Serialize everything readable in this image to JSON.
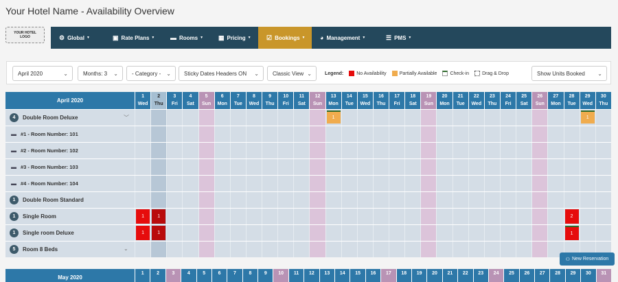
{
  "page_title": "Your Hotel Name - Availability Overview",
  "logo_text": "YOUR HOTEL LOGO",
  "nav": [
    {
      "label": "Global",
      "icon": "gear-icon",
      "glyph": "⚙"
    },
    {
      "label": "Rate Plans",
      "icon": "briefcase-icon",
      "glyph": "▣"
    },
    {
      "label": "Rooms",
      "icon": "bed-icon",
      "glyph": "▬"
    },
    {
      "label": "Pricing",
      "icon": "table-icon",
      "glyph": "▦"
    },
    {
      "label": "Bookings",
      "icon": "calendar-check-icon",
      "glyph": "☑"
    },
    {
      "label": "Management",
      "icon": "pie-chart-icon",
      "glyph": "◕"
    },
    {
      "label": "PMS",
      "icon": "list-icon",
      "glyph": "☰"
    }
  ],
  "toolbar": {
    "month": "April 2020",
    "months": "Months: 3",
    "category": "- Category -",
    "sticky": "Sticky Dates Headers ON",
    "view": "Classic View",
    "legend_label": "Legend:",
    "legend": [
      {
        "label": "No Availability",
        "color": "#e60c0c"
      },
      {
        "label": "Partially Available",
        "color": "#f0ac4e"
      },
      {
        "label": "Check-in",
        "color": "#2f6a2a"
      },
      {
        "label": "Drag & Drop",
        "color": "#333333"
      }
    ],
    "units": "Show Units Booked"
  },
  "calendar1": {
    "title": "April 2020",
    "days": [
      [
        "1",
        "Wed"
      ],
      [
        "2",
        "Thu"
      ],
      [
        "3",
        "Fri"
      ],
      [
        "4",
        "Sat"
      ],
      [
        "5",
        "Sun"
      ],
      [
        "6",
        "Mon"
      ],
      [
        "7",
        "Tue"
      ],
      [
        "8",
        "Wed"
      ],
      [
        "9",
        "Thu"
      ],
      [
        "10",
        "Fri"
      ],
      [
        "11",
        "Sat"
      ],
      [
        "12",
        "Sun"
      ],
      [
        "13",
        "Mon"
      ],
      [
        "14",
        "Tue"
      ],
      [
        "15",
        "Wed"
      ],
      [
        "16",
        "Thu"
      ],
      [
        "17",
        "Fri"
      ],
      [
        "18",
        "Sat"
      ],
      [
        "19",
        "Sun"
      ],
      [
        "20",
        "Mon"
      ],
      [
        "21",
        "Tue"
      ],
      [
        "22",
        "Wed"
      ],
      [
        "23",
        "Thu"
      ],
      [
        "24",
        "Fri"
      ],
      [
        "25",
        "Sat"
      ],
      [
        "26",
        "Sun"
      ],
      [
        "27",
        "Mon"
      ],
      [
        "28",
        "Tue"
      ],
      [
        "29",
        "Wed"
      ],
      [
        "30",
        "Thu"
      ]
    ],
    "rows": [
      {
        "label": "Double Room Deluxe",
        "badge": "4",
        "type": "cat",
        "expand": "﹀"
      },
      {
        "label": "#1 - Room Number: 101",
        "type": "unit"
      },
      {
        "label": "#2 - Room Number: 102",
        "type": "unit"
      },
      {
        "label": "#3 - Room Number: 103",
        "type": "unit"
      },
      {
        "label": "#4 - Room Number: 104",
        "type": "unit"
      },
      {
        "label": "Double Room Standard",
        "badge": "1",
        "type": "cat"
      },
      {
        "label": "Single Room",
        "badge": "1",
        "type": "cat"
      },
      {
        "label": "Single room Deluxe",
        "badge": "1",
        "type": "cat"
      },
      {
        "label": "Room 8 Beds",
        "badge": "5",
        "type": "cat",
        "expand": "⌄"
      }
    ],
    "cells": [
      {
        "row": 0,
        "day": 13,
        "value": "1",
        "kind": "partial"
      },
      {
        "row": 0,
        "day": 29,
        "value": "1",
        "kind": "partial"
      },
      {
        "row": 6,
        "day": 1,
        "value": "1",
        "kind": "full"
      },
      {
        "row": 6,
        "day": 2,
        "value": "1",
        "kind": "full-dark"
      },
      {
        "row": 6,
        "day": 28,
        "value": "2",
        "kind": "full"
      },
      {
        "row": 7,
        "day": 1,
        "value": "1",
        "kind": "full"
      },
      {
        "row": 7,
        "day": 2,
        "value": "1",
        "kind": "full-dark"
      },
      {
        "row": 7,
        "day": 28,
        "value": "1",
        "kind": "full-checkin"
      }
    ]
  },
  "calendar2": {
    "title": "May 2020",
    "days": [
      "1",
      "2",
      "3",
      "4",
      "5",
      "6",
      "7",
      "8",
      "9",
      "10",
      "11",
      "12",
      "13",
      "14",
      "15",
      "16",
      "17",
      "18",
      "19",
      "20",
      "21",
      "22",
      "23",
      "24",
      "25",
      "26",
      "27",
      "28",
      "29",
      "30",
      "31"
    ],
    "sundays": [
      "3",
      "10",
      "17",
      "24",
      "31"
    ]
  },
  "new_reservation": "New Reservation"
}
